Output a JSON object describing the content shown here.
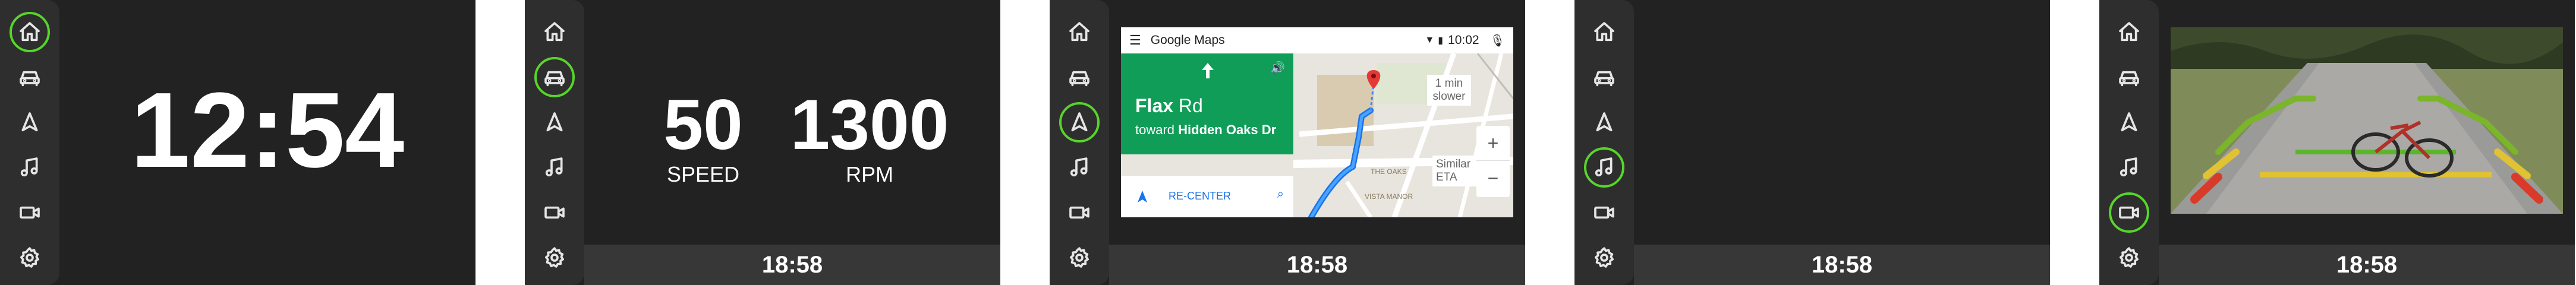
{
  "colors": {
    "active_ring": "#57d52a",
    "screen_bg": "#222222",
    "rail_bg": "#2e2e2e",
    "statusbar_bg": "#373737",
    "nav_green": "#109d58",
    "route_blue": "#4285f4"
  },
  "nav_icons": [
    "home-icon",
    "car-icon",
    "navigation-icon",
    "music-icon",
    "camera-icon",
    "settings-icon"
  ],
  "screens": [
    {
      "name": "home",
      "active": "home",
      "clock": "12:54"
    },
    {
      "name": "vehicle",
      "active": "car",
      "status_time": "18:58",
      "speed_value": "50",
      "speed_label": "SPEED",
      "rpm_value": "1300",
      "rpm_label": "RPM"
    },
    {
      "name": "navigation",
      "active": "navigation",
      "status_time": "18:58"
    },
    {
      "name": "music",
      "active": "music",
      "status_time": "18:58"
    },
    {
      "name": "camera",
      "active": "camera",
      "status_time": "18:58"
    }
  ],
  "maps": {
    "app_title": "Google Maps",
    "time": "10:02",
    "street": "Flax",
    "street_suffix": "Rd",
    "toward_prefix": "toward",
    "toward_street": "Hidden Oaks Dr",
    "recenter": "RE-CENTER",
    "callout_1_line1": "1 min",
    "callout_1_line2": "slower",
    "callout_2_line1": "Similar",
    "callout_2_line2": "ETA",
    "zoom_in": "+",
    "zoom_out": "−",
    "place_1": "THE OAKS",
    "place_2": "VISTA MANOR"
  }
}
